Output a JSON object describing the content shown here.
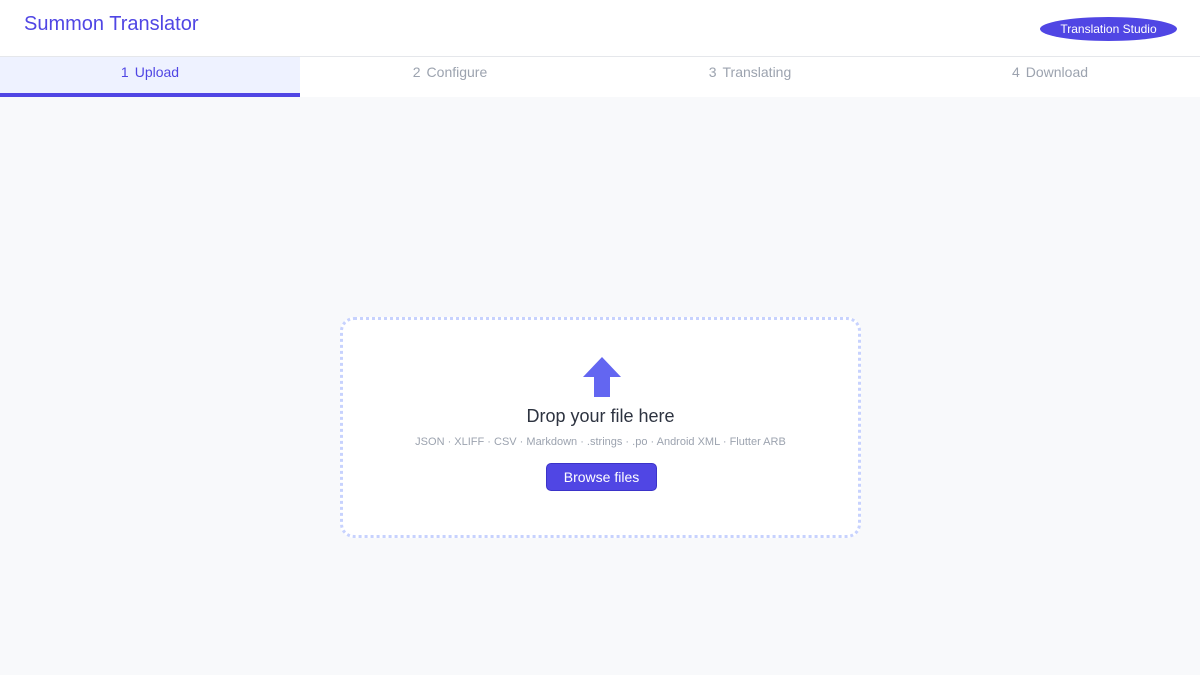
{
  "header": {
    "app_title": "Summon Translator",
    "badge": "Translation Studio"
  },
  "stepper": {
    "steps": [
      {
        "num": "1",
        "label": "Upload",
        "active": true
      },
      {
        "num": "2",
        "label": "Configure",
        "active": false
      },
      {
        "num": "3",
        "label": "Translating",
        "active": false
      },
      {
        "num": "4",
        "label": "Download",
        "active": false
      }
    ]
  },
  "dropzone": {
    "icon": "upload-arrow-icon",
    "title": "Drop your file here",
    "formats": "JSON · XLIFF · CSV · Markdown · .strings · .po · Android XML · Flutter ARB",
    "browse_label": "Browse files"
  },
  "colors": {
    "accent": "#5046e4",
    "arrow": "#6366f1",
    "dropzone_border": "#c7d2fe",
    "active_step_bg": "#eef2ff"
  }
}
